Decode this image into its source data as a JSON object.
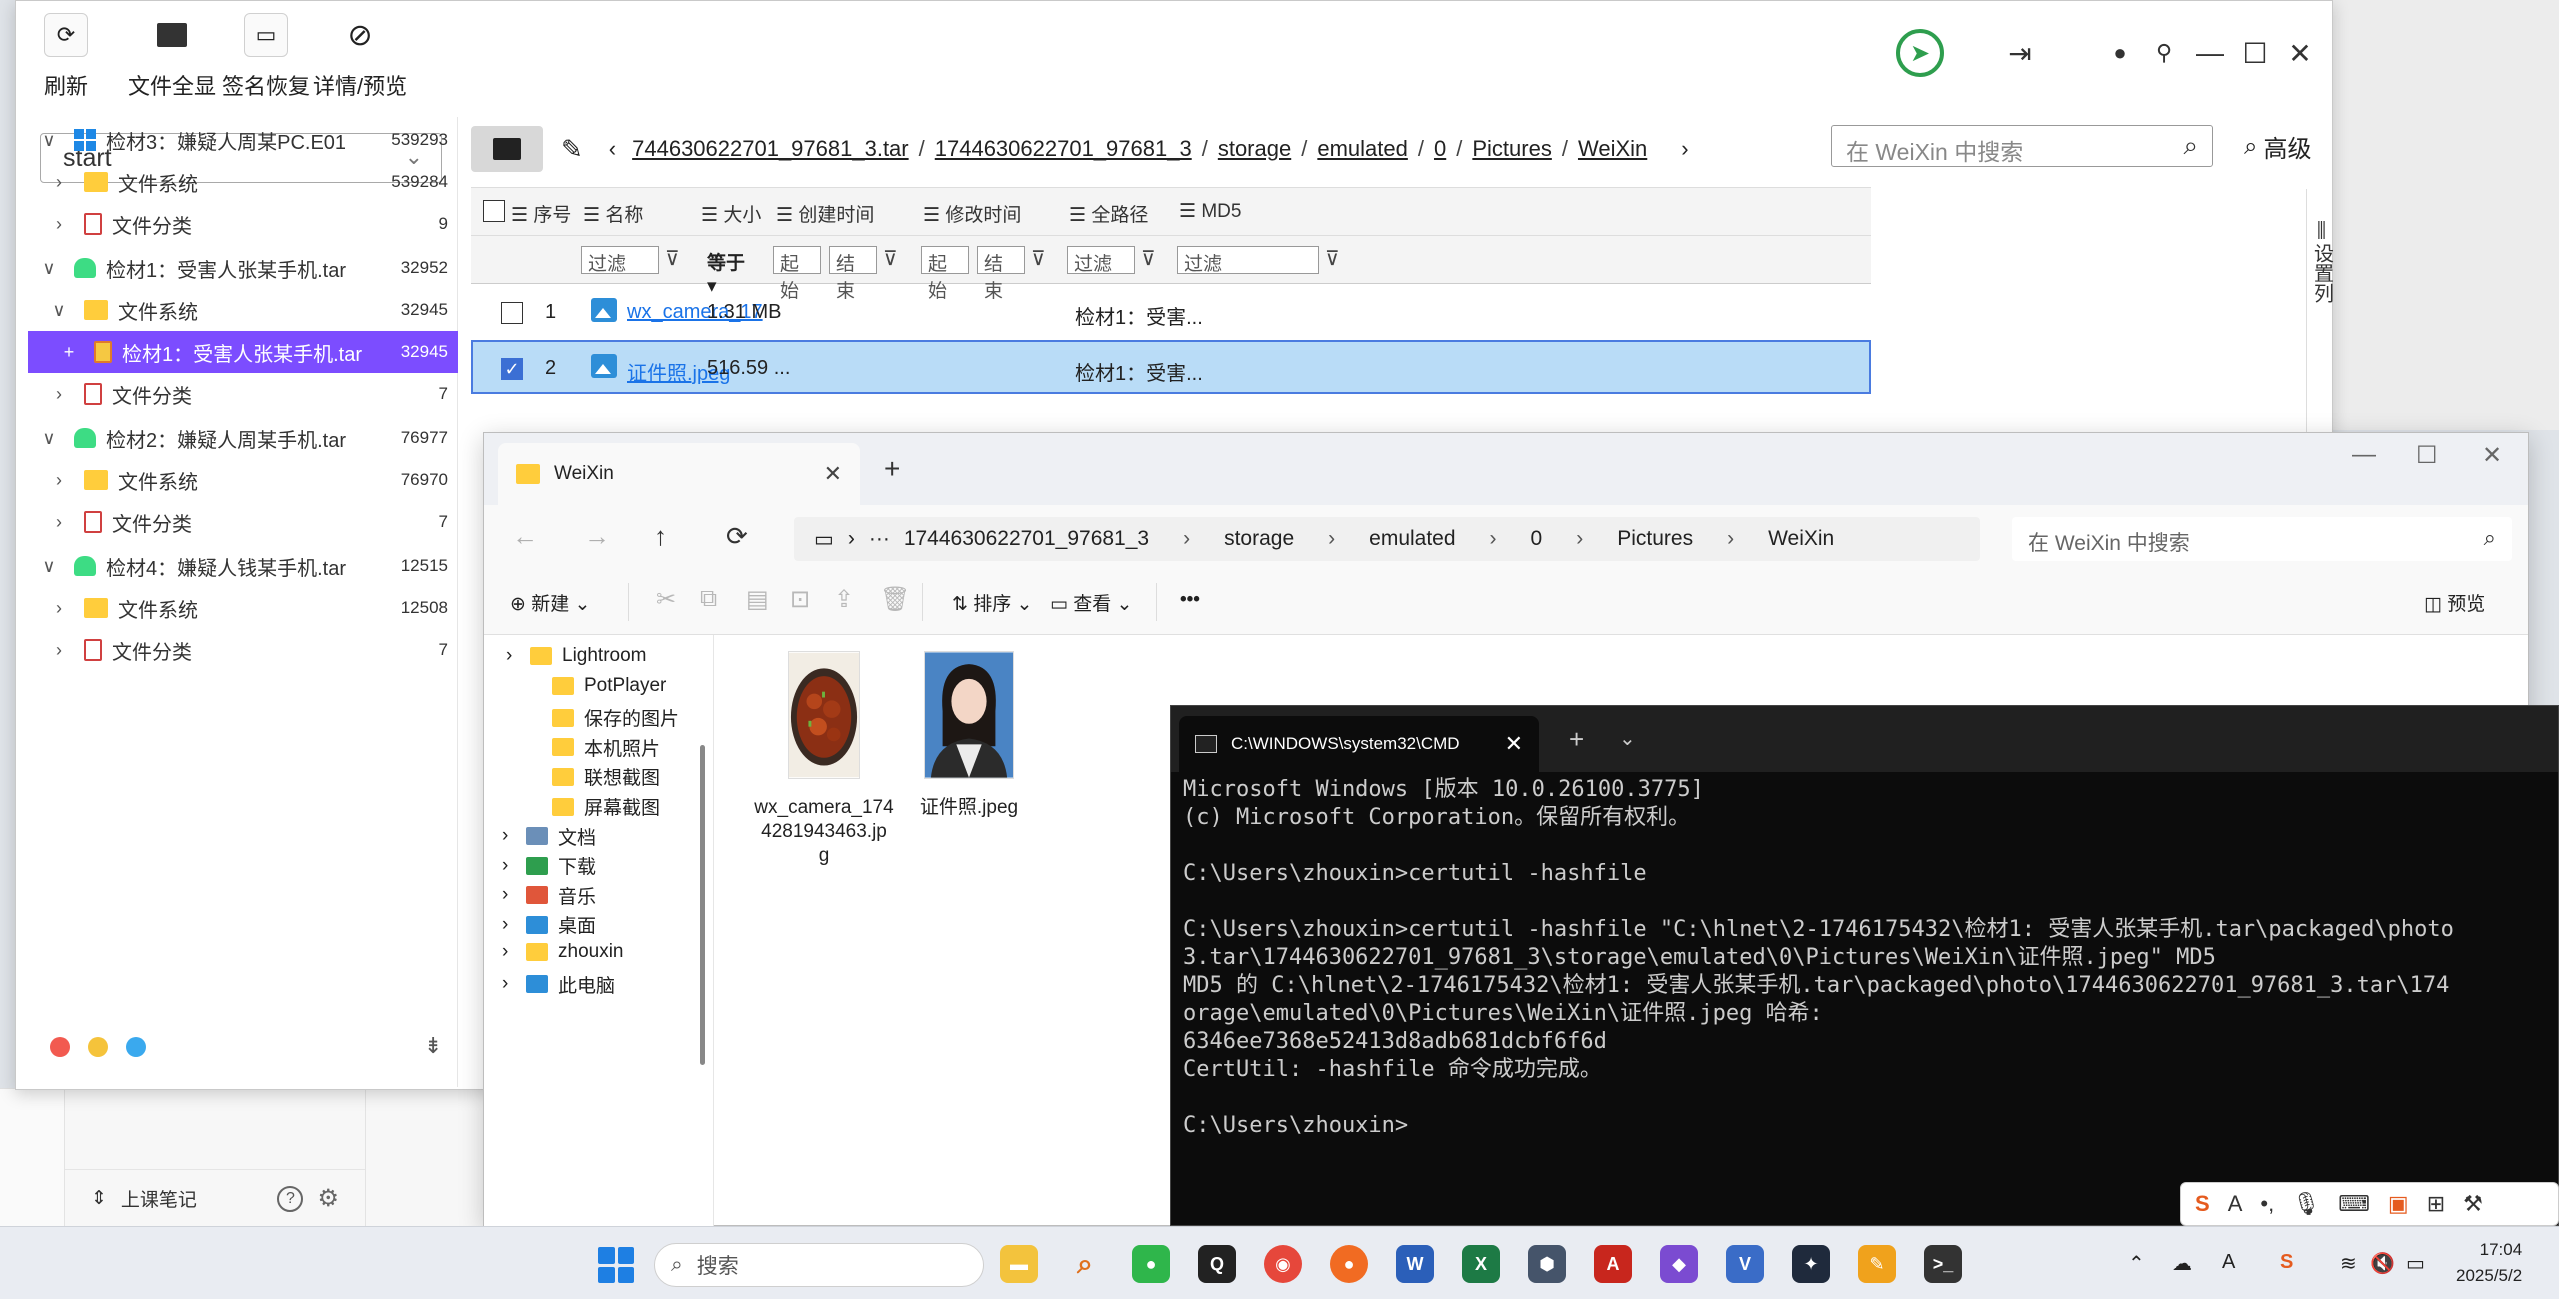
{
  "forensic": {
    "toolbar": {
      "refresh": "刷新",
      "show_all": "文件全显",
      "sig_recover": "签名恢复",
      "detail_preview": "详情/预览"
    },
    "combo_value": "start",
    "tree": [
      {
        "label": "检材3：嫌疑人周某PC.E01",
        "count": "539293",
        "icon": "windows-icon",
        "level": 0,
        "arrow": "∨"
      },
      {
        "label": "文件系统",
        "count": "539284",
        "icon": "folder-icon",
        "level": 1,
        "arrow": "›"
      },
      {
        "label": "文件分类",
        "count": "9",
        "icon": "doc-icon",
        "level": 1,
        "arrow": "›"
      },
      {
        "label": "检材1：受害人张某手机.tar",
        "count": "32952",
        "icon": "android-icon",
        "level": 0,
        "arrow": "∨"
      },
      {
        "label": "文件系统",
        "count": "32945",
        "icon": "folder-icon",
        "level": 1,
        "arrow": "∨"
      },
      {
        "label": "检材1：受害人张某手机.tar",
        "count": "32945",
        "icon": "image-icon",
        "level": 2,
        "arrow": "+"
      },
      {
        "label": "文件分类",
        "count": "7",
        "icon": "doc-icon",
        "level": 1,
        "arrow": "›"
      },
      {
        "label": "检材2：嫌疑人周某手机.tar",
        "count": "76977",
        "icon": "android-icon",
        "level": 0,
        "arrow": "∨"
      },
      {
        "label": "文件系统",
        "count": "76970",
        "icon": "folder-icon",
        "level": 1,
        "arrow": "›"
      },
      {
        "label": "文件分类",
        "count": "7",
        "icon": "doc-icon",
        "level": 1,
        "arrow": "›"
      },
      {
        "label": "检材4：嫌疑人钱某手机.tar",
        "count": "12515",
        "icon": "android-icon",
        "level": 0,
        "arrow": "∨"
      },
      {
        "label": "文件系统",
        "count": "12508",
        "icon": "folder-icon",
        "level": 1,
        "arrow": "›"
      },
      {
        "label": "文件分类",
        "count": "7",
        "icon": "doc-icon",
        "level": 1,
        "arrow": "›"
      }
    ],
    "dot_colors": [
      "#f25a50",
      "#f5c33b",
      "#3aa9ee"
    ],
    "breadcrumb": [
      "744630622701_97681_3.tar",
      "1744630622701_97681_3",
      "storage",
      "emulated",
      "0",
      "Pictures",
      "WeiXin"
    ],
    "search_placeholder": "在 WeiXin 中搜索",
    "advanced": "高级",
    "columns": {
      "seq": "序号",
      "name": "名称",
      "size": "大小",
      "created": "创建时间",
      "modified": "修改时间",
      "fullpath": "全路径",
      "md5": "MD5"
    },
    "filters": {
      "filter": "过滤",
      "equals": "等于",
      "start": "起始",
      "end": "结束"
    },
    "rows": [
      {
        "seq": "1",
        "name": "wx_camera_17",
        "size": "1.31 MB",
        "path": "检材1：受害...",
        "checked": false
      },
      {
        "seq": "2",
        "name": "证件照.jpeg",
        "size": "516.59 ...",
        "path": "检材1：受害...",
        "checked": true
      }
    ],
    "set_columns": "设置列"
  },
  "notes": {
    "label": "上课笔记"
  },
  "explorer": {
    "tab_title": "WeiXin",
    "address": [
      "1744630622701_97681_3",
      "storage",
      "emulated",
      "0",
      "Pictures",
      "WeiXin"
    ],
    "search_placeholder": "在 WeiXin 中搜索",
    "commands": {
      "new": "新建",
      "sort": "排序",
      "view": "查看",
      "more": "•••",
      "preview": "预览"
    },
    "sidebar": [
      {
        "label": "Lightroom",
        "icon": "folder-icon",
        "arrow": "›"
      },
      {
        "label": "PotPlayer",
        "icon": "folder-icon",
        "arrow": ""
      },
      {
        "label": "保存的图片",
        "icon": "folder-icon",
        "arrow": ""
      },
      {
        "label": "本机照片",
        "icon": "folder-icon",
        "arrow": ""
      },
      {
        "label": "联想截图",
        "icon": "folder-icon",
        "arrow": ""
      },
      {
        "label": "屏幕截图",
        "icon": "folder-icon",
        "arrow": ""
      },
      {
        "label": "文档",
        "icon": "documents-icon",
        "arrow": "›"
      },
      {
        "label": "下载",
        "icon": "download-icon",
        "arrow": "›"
      },
      {
        "label": "音乐",
        "icon": "music-icon",
        "arrow": "›"
      },
      {
        "label": "桌面",
        "icon": "desktop-icon",
        "arrow": "›"
      },
      {
        "label": "zhouxin",
        "icon": "folder-icon",
        "arrow": "›"
      },
      {
        "label": "此电脑",
        "icon": "computer-icon",
        "arrow": "›"
      }
    ],
    "files": [
      {
        "name_l1": "wx_camera_174",
        "name_l2": "4281943463.jp",
        "name_l3": "g"
      },
      {
        "name_l1": "证件照.jpeg",
        "name_l2": "",
        "name_l3": ""
      }
    ]
  },
  "cmd": {
    "tab_title": "C:\\WINDOWS\\system32\\CMD",
    "lines": [
      "Microsoft Windows [版本 10.0.26100.3775]",
      "(c) Microsoft Corporation。保留所有权利。",
      "",
      "C:\\Users\\zhouxin>certutil -hashfile",
      "",
      "C:\\Users\\zhouxin>certutil -hashfile \"C:\\hlnet\\2-1746175432\\检材1: 受害人张某手机.tar\\packaged\\photo",
      "3.tar\\1744630622701_97681_3\\storage\\emulated\\0\\Pictures\\WeiXin\\证件照.jpeg\" MD5",
      "MD5 的 C:\\hlnet\\2-1746175432\\检材1: 受害人张某手机.tar\\packaged\\photo\\1744630622701_97681_3.tar\\174",
      "orage\\emulated\\0\\Pictures\\WeiXin\\证件照.jpeg 哈希:",
      "6346ee7368e52413d8adb681dcbf6f6d",
      "CertUtil: -hashfile 命令成功完成。",
      "",
      "C:\\Users\\zhouxin>"
    ]
  },
  "taskbar": {
    "search_placeholder": "搜索",
    "time": "17:04",
    "date": "2025/5/2"
  }
}
